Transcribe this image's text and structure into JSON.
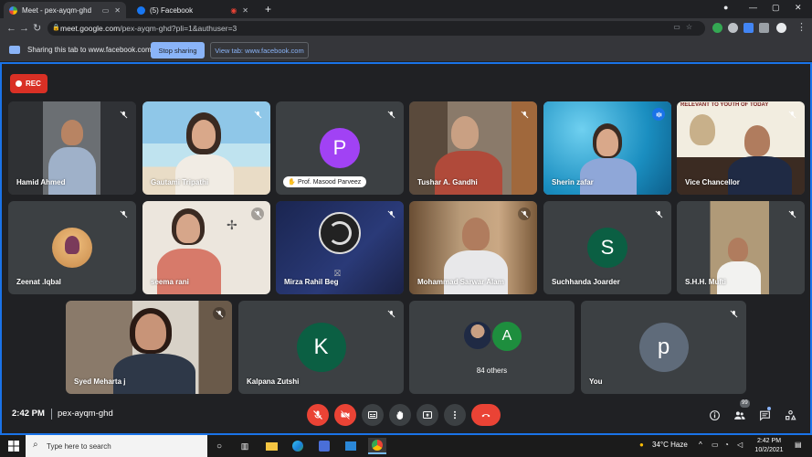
{
  "browser": {
    "tabs": [
      {
        "title": "Meet - pex-ayqm-ghd",
        "active": true
      },
      {
        "title": "(5) Facebook",
        "active": false
      }
    ],
    "url": {
      "domain": "meet.google.com",
      "path": "/pex-ayqm-ghd?pli=1&authuser=3"
    }
  },
  "share_bar": {
    "message": "Sharing this tab to www.facebook.com",
    "stop_label": "Stop sharing",
    "view_label": "View tab: www.facebook.com"
  },
  "meeting": {
    "rec_label": "REC",
    "time": "2:42 PM",
    "code": "pex-ayqm-ghd",
    "participants_count": "99",
    "others_avatar_letter": "A",
    "others_label": "84 others",
    "participants": [
      {
        "name": "Hamid Ahmed"
      },
      {
        "name": "Gautami Tripathi"
      },
      {
        "name": "Prof. Masood Parveez",
        "initial": "P"
      },
      {
        "name": "Tushar A. Gandhi"
      },
      {
        "name": "Sherin zafar"
      },
      {
        "name": "Vice Chancellor",
        "banner": "RELEVANT TO YOUTH OF TODAY"
      },
      {
        "name": "Zeenat .Iqbal"
      },
      {
        "name": "seema rani"
      },
      {
        "name": "Mirza Rahil Beg"
      },
      {
        "name": "Mohammad Sarwar Alam"
      },
      {
        "name": "Suchhanda Joarder",
        "initial": "S"
      },
      {
        "name": "S.H.H. Mufti"
      },
      {
        "name": "Syed Meharta j"
      },
      {
        "name": "Kalpana Zutshi",
        "initial": "K"
      },
      {
        "name": "You",
        "initial": "p"
      }
    ]
  },
  "colors": {
    "meet_bg": "#202124",
    "tile_bg": "#3c4043",
    "accent_blue": "#8ab4f8",
    "red": "#ea4335",
    "avatar_purple": "#a142f4",
    "avatar_green": "#0b5f43",
    "avatar_teal": "#0d652d",
    "avatar_slate": "#5f6b7a"
  },
  "taskbar": {
    "search_placeholder": "Type here to search",
    "weather": "34°C  Haze",
    "time": "2:42 PM",
    "date": "10/2/2021"
  }
}
